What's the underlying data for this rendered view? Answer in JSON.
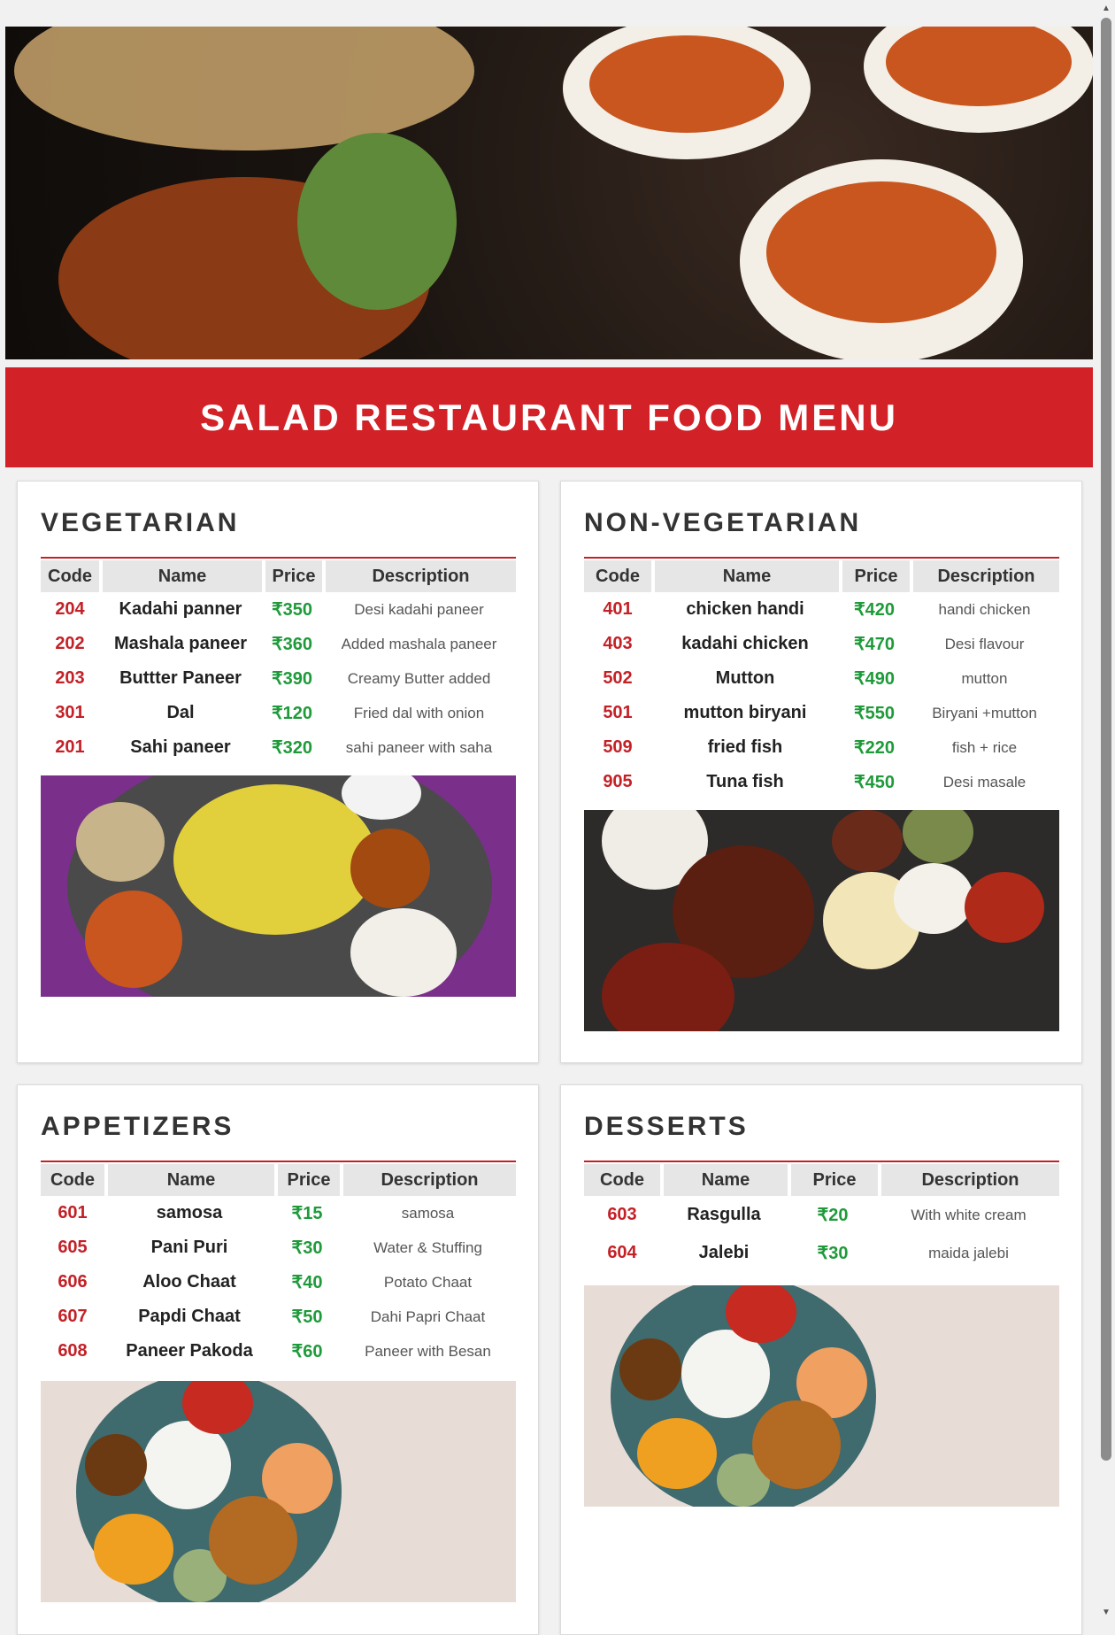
{
  "title": "SALAD RESTAURANT FOOD MENU",
  "colors": {
    "accent": "#d22127",
    "code": "#c42127",
    "price": "#1f9a3a"
  },
  "sections": [
    {
      "heading": "VEGETARIAN",
      "columns": [
        "Code",
        "Name",
        "Price",
        "Description"
      ],
      "rows": [
        [
          "204",
          "Kadahi panner",
          "₹350",
          "Desi kadahi paneer"
        ],
        [
          "202",
          "Mashala paneer",
          "₹360",
          "Added mashala paneer"
        ],
        [
          "203",
          "Buttter Paneer",
          "₹390",
          "Creamy Butter added"
        ],
        [
          "301",
          "Dal",
          "₹120",
          "Fried dal with onion"
        ],
        [
          "201",
          "Sahi paneer",
          "₹320",
          "sahi paneer with saha"
        ]
      ]
    },
    {
      "heading": "NON-VEGETARIAN",
      "columns": [
        "Code",
        "Name",
        "Price",
        "Description"
      ],
      "rows": [
        [
          "401",
          "chicken handi",
          "₹420",
          "handi chicken"
        ],
        [
          "403",
          "kadahi chicken",
          "₹470",
          "Desi flavour"
        ],
        [
          "502",
          "Mutton",
          "₹490",
          "mutton"
        ],
        [
          "501",
          "mutton biryani",
          "₹550",
          "Biryani +mutton"
        ],
        [
          "509",
          "fried fish",
          "₹220",
          "fish + rice"
        ],
        [
          "905",
          "Tuna fish",
          "₹450",
          "Desi masale"
        ]
      ]
    },
    {
      "heading": "APPETIZERS",
      "columns": [
        "Code",
        "Name",
        "Price",
        "Description"
      ],
      "rows": [
        [
          "601",
          "samosa",
          "₹15",
          "samosa"
        ],
        [
          "605",
          "Pani Puri",
          "₹30",
          "Water & Stuffing"
        ],
        [
          "606",
          "Aloo Chaat",
          "₹40",
          "Potato Chaat"
        ],
        [
          "607",
          "Papdi Chaat",
          "₹50",
          "Dahi Papri Chaat"
        ],
        [
          "608",
          "Paneer Pakoda",
          "₹60",
          "Paneer with Besan"
        ]
      ]
    },
    {
      "heading": "DESSERTS",
      "columns": [
        "Code",
        "Name",
        "Price",
        "Description"
      ],
      "rows": [
        [
          "603",
          "Rasgulla",
          "₹20",
          "With white cream"
        ],
        [
          "604",
          "Jalebi",
          "₹30",
          "maida jalebi"
        ]
      ]
    }
  ]
}
